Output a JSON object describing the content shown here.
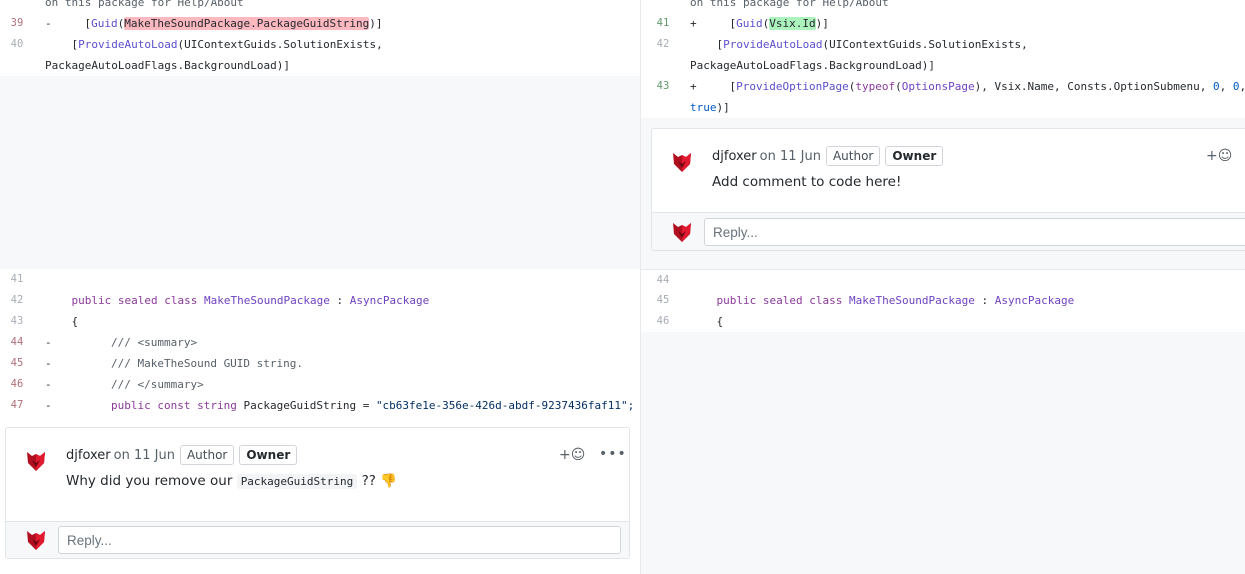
{
  "left": {
    "lines": [
      {
        "text": "on this package for Help/About"
      },
      {
        "num": "39",
        "marker": "-",
        "code_pre": "    [",
        "code_attr": "Guid",
        "code_paren": "(",
        "code_hl": "MakeTheSoundPackage.PackageGuidString",
        "code_post": ")]"
      },
      {
        "num": "40",
        "code_pre": "    [",
        "code_attr": "ProvideAutoLoad",
        "code_post": "(UIContextGuids.SolutionExists,",
        "cont": "PackageAutoLoadFlags.BackgroundLoad)]"
      },
      {
        "num": "41"
      },
      {
        "num": "42",
        "code_pre": "    ",
        "k1": "public",
        "k2": "sealed",
        "k3": "class",
        "cls": "MakeTheSoundPackage",
        "sep": " : ",
        "base": "AsyncPackage"
      },
      {
        "num": "43",
        "code": "    {"
      },
      {
        "num": "44",
        "marker": "-",
        "code": "        /// <summary>"
      },
      {
        "num": "45",
        "marker": "-",
        "code": "        /// MakeTheSound GUID string."
      },
      {
        "num": "46",
        "marker": "-",
        "code": "        /// </summary>"
      },
      {
        "num": "47",
        "marker": "-",
        "code_pre": "        ",
        "k1": "public",
        "k2": "const",
        "k3": "string",
        "name": " PackageGuidString = ",
        "str": "\"cb63fe1e-356e-426d-abdf-9237436faf11\";"
      }
    ],
    "comment": {
      "author": "djfoxer",
      "date": "on 11 Jun",
      "badge_author": "Author",
      "badge_owner": "Owner",
      "text_before": "Why did you remove our ",
      "text_code": "PackageGuidString",
      "text_after": " ??",
      "emoji": "👎",
      "react_label": "+☺",
      "more_label": "•••",
      "reply_placeholder": "Reply..."
    }
  },
  "right": {
    "lines": [
      {
        "text": "on this package for Help/About"
      },
      {
        "num": "41",
        "marker": "+",
        "code_pre": "    [",
        "code_attr": "Guid",
        "code_paren": "(",
        "code_hl": "Vsix.Id",
        "code_post": ")]"
      },
      {
        "num": "42",
        "code_pre": "    [",
        "code_attr": "ProvideAutoLoad",
        "code_post": "(UIContextGuids.SolutionExists,",
        "cont": "PackageAutoLoadFlags.BackgroundLoad)]"
      },
      {
        "num": "43",
        "marker": "+",
        "code_pre": "    [",
        "code_attr": "ProvideOptionPage",
        "p1": "(",
        "typeof": "typeof",
        "p2": "(",
        "opt": "OptionsPage",
        "p3": "), Vsix.Name, Consts.OptionSubmenu, ",
        "z1": "0",
        "c1": ", ",
        "z2": "0",
        "c2": ",",
        "cont_true": "true",
        "cont_end": ")]"
      },
      {
        "num": "44"
      },
      {
        "num": "45",
        "code_pre": "    ",
        "k1": "public",
        "k2": "sealed",
        "k3": "class",
        "cls": "MakeTheSoundPackage",
        "sep": " : ",
        "base": "AsyncPackage"
      },
      {
        "num": "46",
        "code": "    {"
      }
    ],
    "comment": {
      "author": "djfoxer",
      "date": "on 11 Jun",
      "badge_author": "Author",
      "badge_owner": "Owner",
      "text": "Add comment to code here!",
      "react_label": "+☺",
      "reply_placeholder": "Reply..."
    }
  },
  "colors": {
    "deleted_bg": "#ffeef0",
    "added_bg": "#e6ffed",
    "deleted_highlight": "#fdb8c0",
    "added_highlight": "#acf2bd",
    "avatar_red": "#c8102e"
  }
}
